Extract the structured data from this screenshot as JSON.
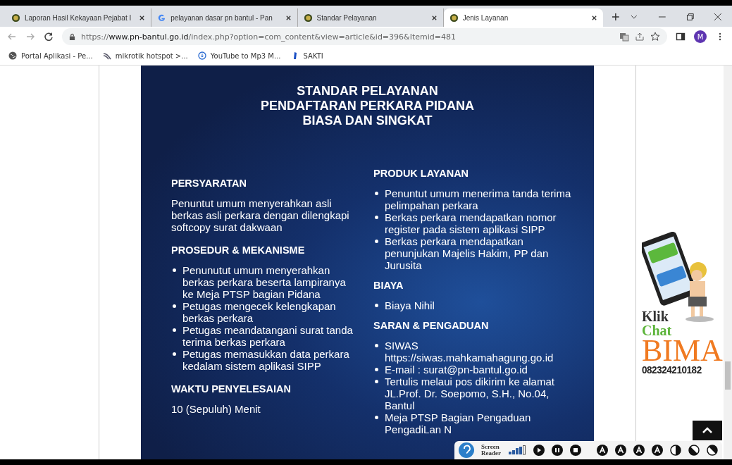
{
  "tabs": [
    {
      "title": "Laporan Hasil Kekayaan Pejabat I",
      "selected": false
    },
    {
      "title": "pelayanan dasar pn bantul - Pan",
      "selected": false
    },
    {
      "title": "Standar Pelayanan",
      "selected": false
    },
    {
      "title": "Jenis Layanan",
      "selected": true
    }
  ],
  "address": {
    "scheme": "https://",
    "host": "www.pn-bantul.go.id",
    "path": "/index.php?option=com_content&view=article&id=396&Itemid=481"
  },
  "profile": {
    "initial": "M"
  },
  "bookmarks": [
    {
      "label": "Portal Aplikasi - Pe..."
    },
    {
      "label": "mikrotik hotspot >..."
    },
    {
      "label": "YouTube to Mp3 M..."
    },
    {
      "label": "SAKTI"
    }
  ],
  "poster": {
    "title": [
      "STANDAR PELAYANAN",
      "PENDAFTARAN PERKARA PIDANA",
      "BIASA DAN SINGKAT"
    ],
    "left": [
      {
        "heading": "PERSYARATAN",
        "kind": "text",
        "text": "Penuntut umum menyerahkan asli berkas asli perkara dengan dilengkapi softcopy surat dakwaan"
      },
      {
        "heading": "PROSEDUR & MEKANISME",
        "kind": "list",
        "items": [
          "Penunutut umum menyerahkan berkas perkara beserta lampiranya ke Meja PTSP bagian Pidana",
          "Petugas mengecek kelengkapan berkas perkara",
          "Petugas meandatangani surat tanda terima berkas perkara",
          "Petugas memasukkan data perkara kedalam sistem aplikasi SIPP"
        ]
      },
      {
        "heading": "WAKTU PENYELESAIAN",
        "kind": "text",
        "text": "10 (Sepuluh) Menit"
      }
    ],
    "right": [
      {
        "heading": "PRODUK LAYANAN",
        "kind": "list",
        "items": [
          "Penuntut umum menerima tanda terima pelimpahan perkara",
          "Berkas perkara mendapatkan nomor register pada sistem aplikasi SIPP",
          "Berkas perkara mendapatkan penunjukan Majelis Hakim, PP dan Jurusita"
        ]
      },
      {
        "heading": "BIAYA",
        "kind": "list",
        "items": [
          "Biaya Nihil"
        ]
      },
      {
        "heading": "SARAN & PENGADUAN",
        "kind": "list",
        "items": [
          "SIWAS https://siwas.mahkamahagung.go.id",
          "E-mail : surat@pn-bantul.go.id",
          "Tertulis melaui pos dikirim ke alamat JL.Prof. Dr. Soepomo, S.H., No.04, Bantul",
          "Meja PTSP Bagian Pengaduan PengadiLan N"
        ]
      }
    ]
  },
  "chat": {
    "line1": "Klik",
    "line2": "Chat",
    "line3": "BIMA",
    "phone": "082324210182"
  },
  "screen_reader": {
    "label": [
      "Screen",
      "Reader"
    ]
  }
}
